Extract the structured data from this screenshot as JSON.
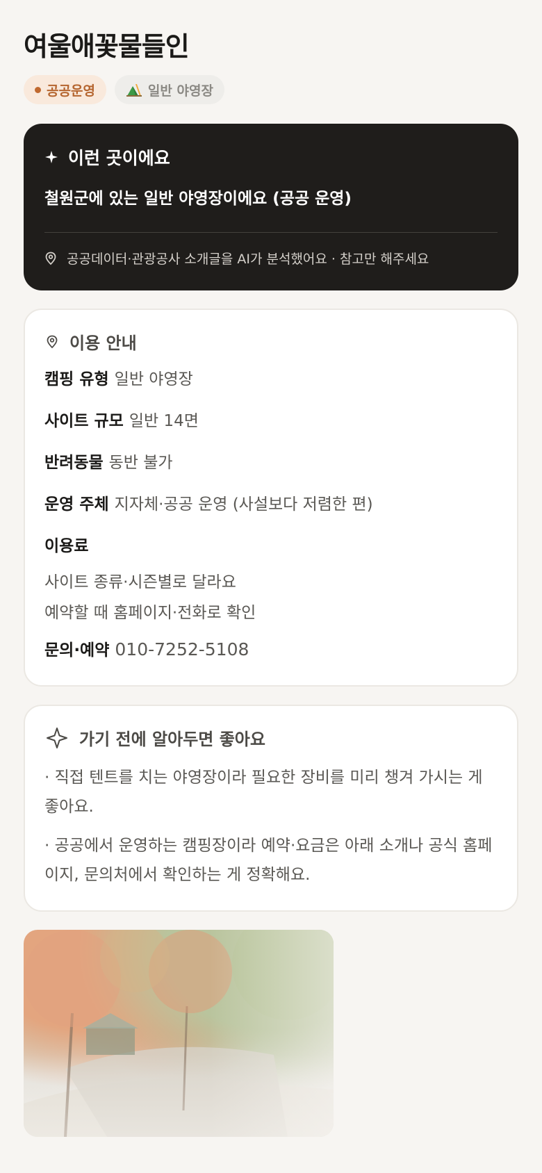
{
  "title": "여울애꽃물들인",
  "tags": {
    "public": "공공운영",
    "type": "일반 야영장"
  },
  "ai_card": {
    "heading": "이런 곳이에요",
    "summary": "철원군에 있는 일반 야영장이에요 (공공 운영)",
    "note": "공공데이터·관광공사 소개글을 AI가 분석했어요 · 참고만 해주세요"
  },
  "info": {
    "heading": "이용 안내",
    "rows": [
      {
        "label": "캠핑 유형",
        "value": "일반 야영장"
      },
      {
        "label": "사이트 규모",
        "value": "일반 14면"
      },
      {
        "label": "반려동물",
        "value": "동반 불가"
      },
      {
        "label": "운영 주체",
        "value": "지자체·공공 운영 (사설보다 저렴한 편)"
      }
    ],
    "fee_label": "이용료",
    "fee_lines": [
      "사이트 종류·시즌별로 달라요",
      "예약할 때 홈페이지·전화로 확인"
    ],
    "contact_label": "문의·예약",
    "contact_value": "010-7252-5108"
  },
  "tips": {
    "heading": "가기 전에 알아두면 좋아요",
    "items": [
      "· 직접 텐트를 치는 야영장이라 필요한 장비를 미리 챙겨 가시는 게 좋아요.",
      "· 공공에서 운영하는 캠핑장이라 예약·요금은 아래 소개나 공식 홈페이지, 문의처에서 확인하는 게 정확해요."
    ]
  },
  "colors": {
    "accent": "#c0692f",
    "dark_card": "#1f1d1b",
    "background": "#f7f5f2"
  }
}
